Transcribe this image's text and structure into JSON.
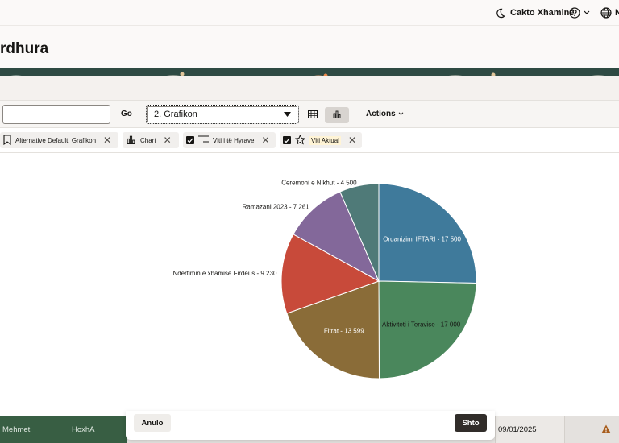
{
  "header": {
    "theme_label": "Cakto Xhaminë",
    "user_initial": "N"
  },
  "page": {
    "title": "rdhura"
  },
  "toolbar": {
    "search_value": "",
    "go_label": "Go",
    "report_select_value": "2. Grafikon",
    "actions_label": "Actions"
  },
  "filters": [
    {
      "label": "Alternative Default: Grafikon"
    },
    {
      "label": "Chart"
    },
    {
      "label": "Viti i të Hyrave"
    },
    {
      "label": "Viti Aktual"
    }
  ],
  "chart_data": {
    "type": "pie",
    "slices": [
      {
        "label": "Organizimi IFTARI - 17 500",
        "value": 17500,
        "color": "#3f7a9b"
      },
      {
        "label": "Aktiviteti i Teravise - 17 000",
        "value": 17000,
        "color": "#4a875c"
      },
      {
        "label": "Fitrat - 13 599",
        "value": 13599,
        "color": "#8a6c38"
      },
      {
        "label": "Ndertimin e xhamise Firdeus - 9 230",
        "value": 9230,
        "color": "#c84a3a"
      },
      {
        "label": "Ramazani 2023 - 7 261",
        "value": 7261,
        "color": "#83689a"
      },
      {
        "label": "Ceremoni e Nikhut - 4 500",
        "value": 4500,
        "color": "#4f7a78"
      }
    ]
  },
  "table": {
    "row": {
      "first_name": "Mehmet",
      "last_name": "HoxhA",
      "date": "09/01/2025"
    }
  },
  "dialog": {
    "cancel_label": "Anulo",
    "add_label": "Shto"
  }
}
